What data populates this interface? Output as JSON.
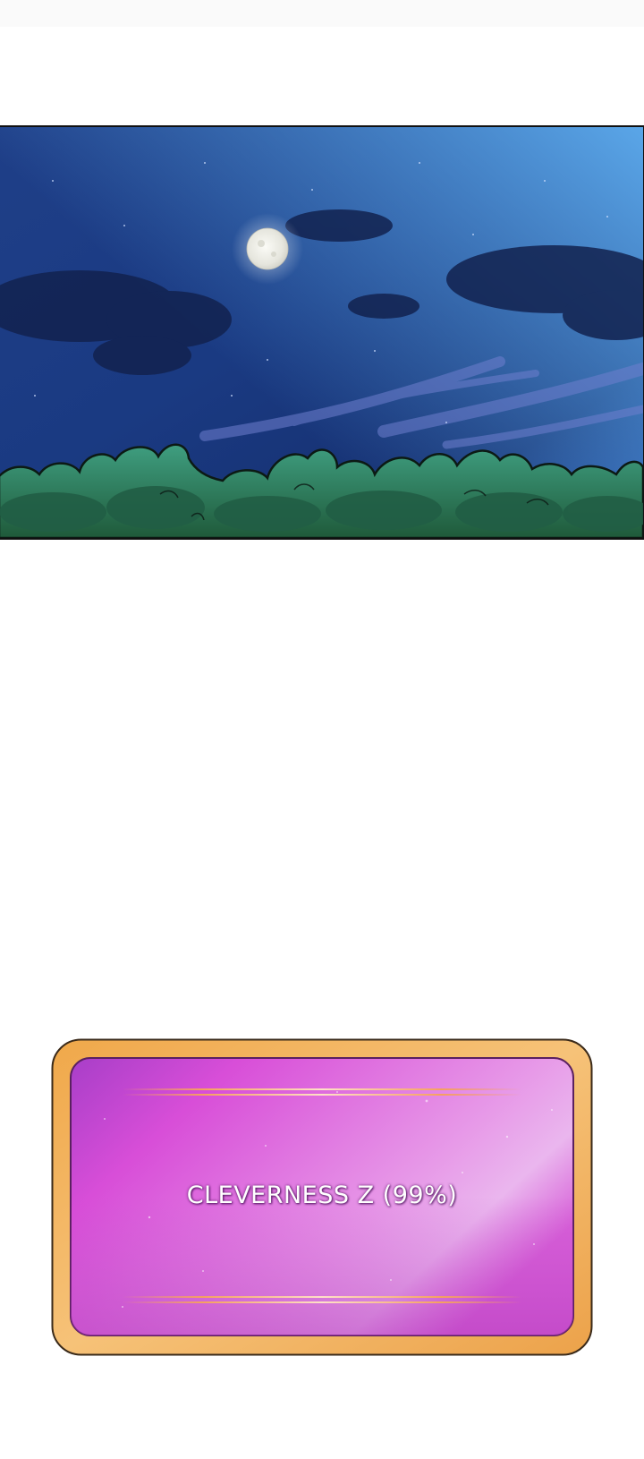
{
  "colors": {
    "sky_top": "#4d9be0",
    "sky_mid": "#1d3f8c",
    "sky_bottom": "#13265a",
    "moon": "#f2f2ee",
    "bushes": "#2e8a6a",
    "frame_gold": "#f2b45a",
    "panel_magenta": "#d64fd8",
    "panel_highlight": "#ecb6f0"
  },
  "icons": {
    "moon": "moon-icon"
  },
  "stat_window": {
    "text": "CLEVERNESS Z (99%)"
  }
}
